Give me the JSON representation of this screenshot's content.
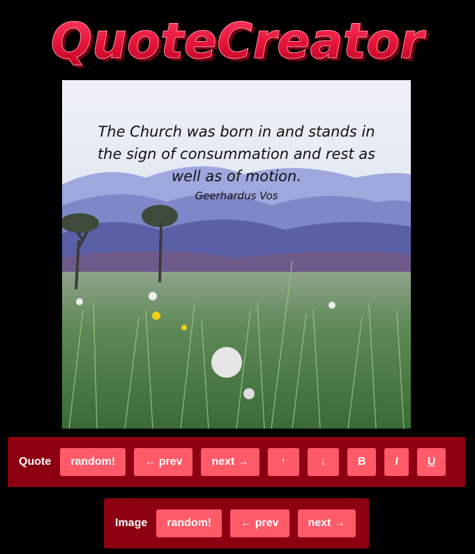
{
  "app": {
    "title": "QuoteCreator",
    "colors": {
      "accent": "#ff5a68",
      "panel": "#8d0012",
      "logo": "#e8163c",
      "background": "#000000"
    }
  },
  "quote": {
    "text": "The Church was born in and stands in the sign of consummation and rest as well as of motion.",
    "author": "Geerhardus Vos"
  },
  "quote_controls": {
    "label": "Quote",
    "random_label": "random!",
    "prev_label": "← prev",
    "next_label": "next →",
    "up_label": "↑",
    "down_label": "↓",
    "bold_label": "B",
    "italic_label": "I",
    "underline_label": "U"
  },
  "image_controls": {
    "label": "Image",
    "random_label": "random!",
    "prev_label": "← prev",
    "next_label": "next →"
  }
}
